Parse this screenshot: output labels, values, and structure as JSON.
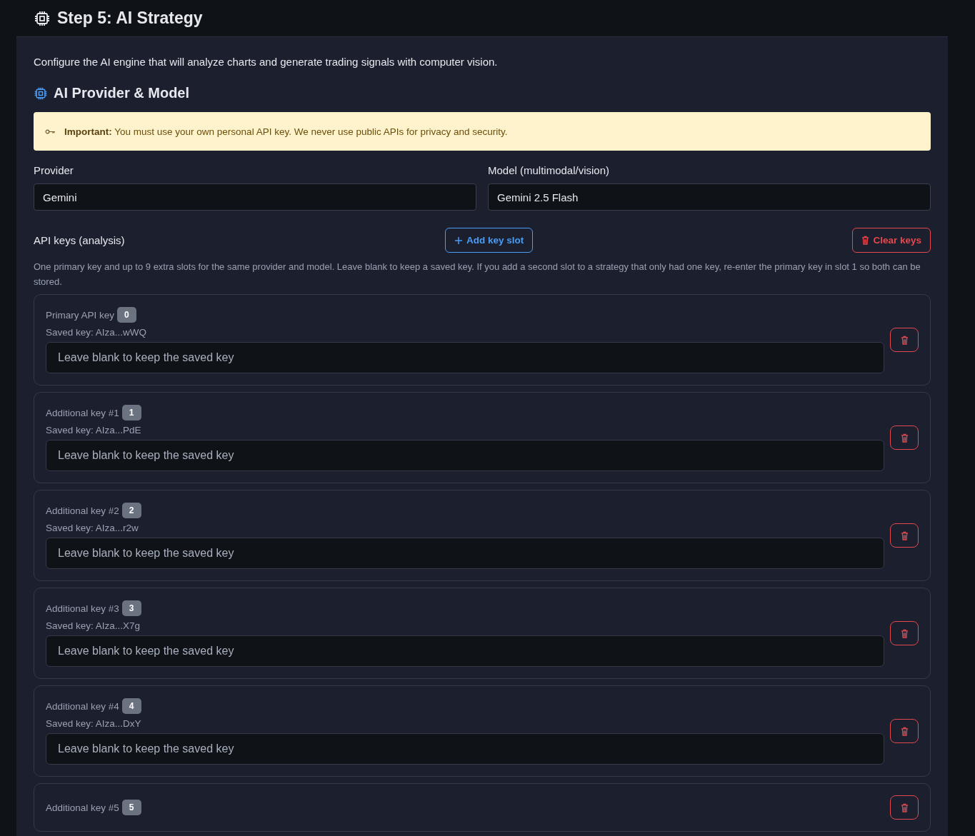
{
  "header": {
    "title": "Step 5: AI Strategy"
  },
  "intro": "Configure the AI engine that will analyze charts and generate trading signals with computer vision.",
  "section": {
    "title": "AI Provider & Model"
  },
  "notice": {
    "text": "**Important:** You must use your own personal API key. We never use public APIs for privacy and security."
  },
  "fields": [
    {
      "label": "Provider",
      "value": "Gemini"
    },
    {
      "label": "Model (multimodal/vision)",
      "value": "Gemini 2.5 Flash"
    }
  ],
  "api_keys": {
    "label": "API keys (analysis)",
    "add_button": "Add key slot",
    "clear_button": "Clear keys",
    "help": "One primary key and up to 9 extra slots for the same provider and model. Leave blank to keep a saved key. If you add a second slot to a strategy that only had one key, re-enter the primary key in slot 1 so both can be stored.",
    "slots": [
      {
        "label": "Primary API key",
        "badge": "0",
        "saved_key": "Saved key: AIza...wWQ",
        "placeholder": "Leave blank to keep the saved key"
      },
      {
        "label": "Additional key #1",
        "badge": "1",
        "saved_key": "Saved key: AIza...PdE",
        "placeholder": "Leave blank to keep the saved key"
      },
      {
        "label": "Additional key #2",
        "badge": "2",
        "saved_key": "Saved key: AIza...r2w",
        "placeholder": "Leave blank to keep the saved key"
      },
      {
        "label": "Additional key #3",
        "badge": "3",
        "saved_key": "Saved key: AIza...X7g",
        "placeholder": "Leave blank to keep the saved key"
      },
      {
        "label": "Additional key #4",
        "badge": "4",
        "saved_key": "Saved key: AIza...DxY",
        "placeholder": "Leave blank to keep the saved key"
      },
      {
        "label": "Additional key #5",
        "badge": "5"
      }
    ]
  }
}
